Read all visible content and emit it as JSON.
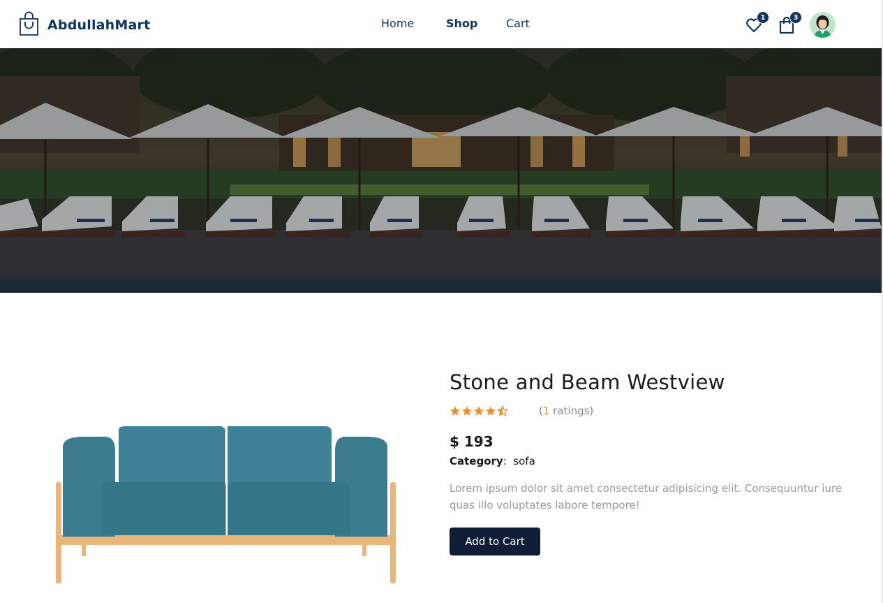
{
  "header": {
    "brand_name": "AbdullahMart",
    "nav": [
      {
        "label": "Home"
      },
      {
        "label": "Shop"
      },
      {
        "label": "Cart"
      }
    ],
    "wishlist_count": "1",
    "cart_count": "3",
    "icons": {
      "brand": "shopping-bag-icon",
      "wishlist": "heart-icon",
      "cart": "bag-icon",
      "user": "avatar"
    },
    "colors": {
      "primary": "#0f3460",
      "button": "#0f1e36",
      "star": "#f28b2c"
    }
  },
  "product": {
    "title": "Stone and Beam Westview",
    "rating": 4.5,
    "ratings_open": "(",
    "ratings_count": "1",
    "ratings_close": " ratings)",
    "price": "$ 193",
    "category_label": "Category",
    "category_sep": ":",
    "category_value": "sofa",
    "description": "Lorem ipsum dolor sit amet consectetur adipisicing elit. Consequuntur iure quas illo voluptates labore tempore!",
    "add_to_cart_label": "Add to Cart"
  }
}
